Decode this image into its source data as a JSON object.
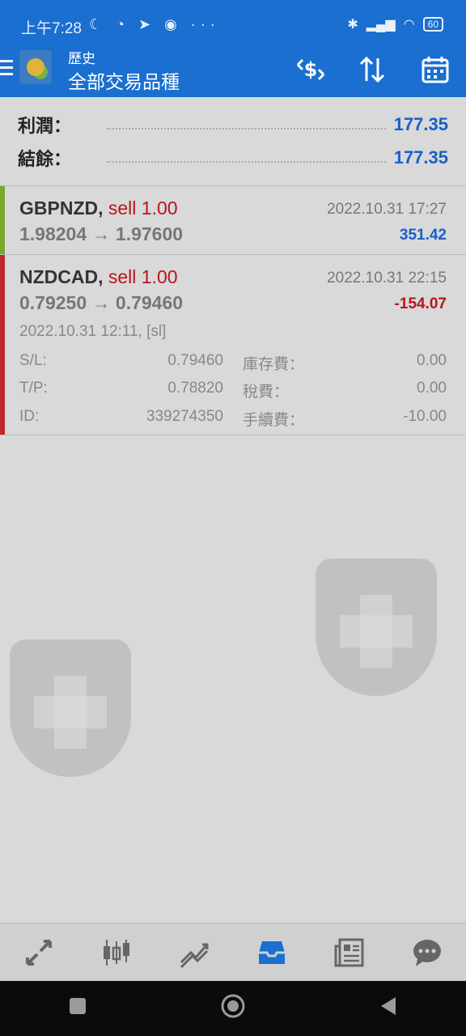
{
  "status_bar": {
    "time": "上午7:28",
    "left_icons": "☾ ◔ ➤ ◉ ···",
    "battery": "60"
  },
  "toolbar": {
    "subtitle": "歷史",
    "title": "全部交易品種",
    "icons": [
      "deposit-icon",
      "sort-icon",
      "calendar-icon"
    ]
  },
  "summary": {
    "profit_label": "利潤：",
    "profit_value": "177.35",
    "balance_label": "結餘：",
    "balance_value": "177.35"
  },
  "trades": [
    {
      "symbol": "GBPNZD,",
      "side": "sell 1.00",
      "prices": "1.98204 → 1.97600",
      "time": "2022.10.31 17:27",
      "profit": "351.42",
      "bar_color": "#7aa82a",
      "profit_color": "#1a5fc8"
    },
    {
      "symbol": "NZDCAD,",
      "side": "sell 1.00",
      "prices": "0.79250 → 0.79460",
      "time": "2022.10.31 22:15",
      "profit": "-154.07",
      "bar_color": "#c0282d",
      "profit_color": "#b9151a",
      "detail": {
        "open": "2022.10.31 12:11, [sl]",
        "sl_label": "S/L:",
        "sl_value": "0.79460",
        "tp_label": "T/P:",
        "tp_value": "0.78820",
        "id_label": "ID:",
        "id_value": "339274350",
        "swap_label": "庫存費：",
        "swap_value": "0.00",
        "tax_label": "稅費：",
        "tax_value": "0.00",
        "commission_label": "手續費：",
        "commission_value": "-10.00"
      }
    }
  ],
  "bottom_nav": {
    "items": [
      "quotes-icon",
      "chart-icon",
      "trade-icon",
      "history-icon",
      "news-icon",
      "chat-icon"
    ],
    "active": "history-icon"
  }
}
